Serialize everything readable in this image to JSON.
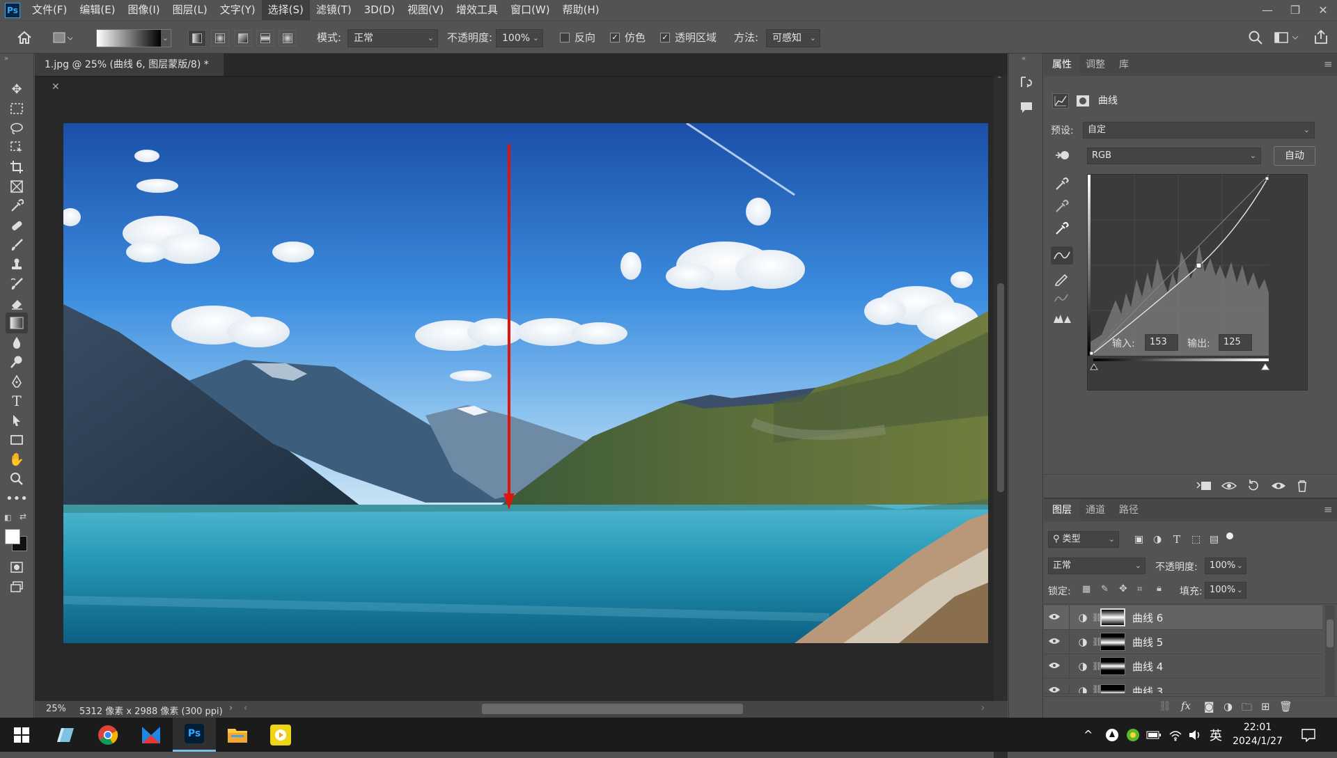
{
  "menubar": {
    "logo": "Ps",
    "items": [
      "文件(F)",
      "编辑(E)",
      "图像(I)",
      "图层(L)",
      "文字(Y)",
      "选择(S)",
      "滤镜(T)",
      "3D(D)",
      "视图(V)",
      "增效工具",
      "窗口(W)",
      "帮助(H)"
    ]
  },
  "options": {
    "mode_label": "模式:",
    "mode_value": "正常",
    "opacity_label": "不透明度:",
    "opacity_value": "100%",
    "reverse_label": "反向",
    "dither_label": "仿色",
    "transparency_label": "透明区域",
    "method_label": "方法:",
    "method_value": "可感知"
  },
  "document": {
    "tab_title": "1.jpg @ 25% (曲线 6, 图层蒙版/8) *",
    "zoom": "25%",
    "info": "5312 像素 x 2988 像素 (300 ppi)"
  },
  "properties": {
    "tabs": [
      "属性",
      "调整",
      "库"
    ],
    "panel_title": "曲线",
    "preset_label": "预设:",
    "preset_value": "自定",
    "channel_value": "RGB",
    "auto_label": "自动",
    "input_label": "输入:",
    "input_value": "153",
    "output_label": "输出:",
    "output_value": "125"
  },
  "layers": {
    "tabs": [
      "图层",
      "通道",
      "路径"
    ],
    "filter_label": "类型",
    "blend_mode": "正常",
    "opacity_label": "不透明度:",
    "opacity_value": "100%",
    "lock_label": "锁定:",
    "fill_label": "填充:",
    "fill_value": "100%",
    "items": [
      {
        "name": "曲线 6",
        "selected": true
      },
      {
        "name": "曲线 5",
        "selected": false
      },
      {
        "name": "曲线 4",
        "selected": false
      },
      {
        "name": "曲线 3",
        "selected": false
      }
    ]
  },
  "taskbar": {
    "ime": "英",
    "time": "22:01",
    "date": "2024/1/27"
  },
  "colors": {
    "arrow": "#e0140e",
    "ps_blue": "#31a8ff",
    "ui_bg": "#535353"
  }
}
